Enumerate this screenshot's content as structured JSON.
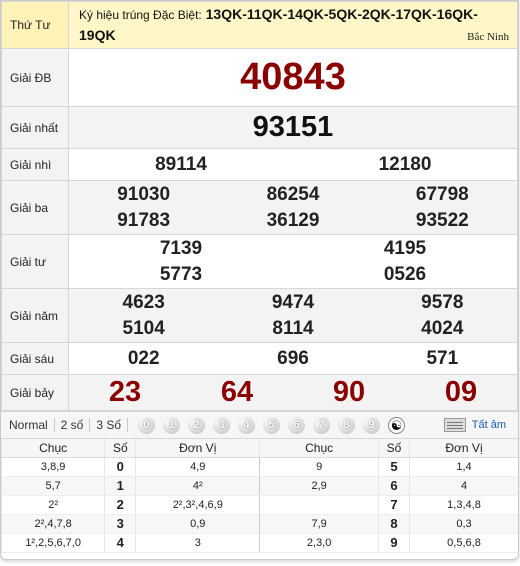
{
  "header": {
    "day_label": "Thứ Tư",
    "special_prefix": "Ký hiệu trúng Đặc Biệt:",
    "special_codes": "13QK-11QK-14QK-5QK-2QK-17QK-16QK-19QK",
    "province": "Bắc Ninh"
  },
  "prizes": {
    "db": {
      "label": "Giải ĐB",
      "values": [
        "40843"
      ]
    },
    "nhat": {
      "label": "Giải nhất",
      "values": [
        "93151"
      ]
    },
    "nhi": {
      "label": "Giải nhì",
      "values": [
        "89114",
        "12180"
      ]
    },
    "ba": {
      "label": "Giải ba",
      "values": [
        "91030",
        "86254",
        "67798",
        "91783",
        "36129",
        "93522"
      ]
    },
    "tu": {
      "label": "Giải tư",
      "values": [
        "7139",
        "4195",
        "5773",
        "0526"
      ]
    },
    "nam": {
      "label": "Giải năm",
      "values": [
        "4623",
        "9474",
        "9578",
        "5104",
        "8114",
        "4024"
      ]
    },
    "sau": {
      "label": "Giải sáu",
      "values": [
        "022",
        "696",
        "571"
      ]
    },
    "bay": {
      "label": "Giải bảy",
      "values": [
        "23",
        "64",
        "90",
        "09"
      ]
    }
  },
  "toolbar": {
    "options": [
      "Normal",
      "2 số",
      "3 Số"
    ],
    "digits": [
      "0",
      "1",
      "2",
      "3",
      "4",
      "5",
      "6",
      "7",
      "8",
      "9"
    ],
    "all_label": "Tất âm",
    "icons": [
      "yin-yang-icon",
      "numbers-icon"
    ]
  },
  "loto": {
    "headers": [
      "Chục",
      "Số",
      "Đơn Vị",
      "Chục",
      "Số",
      "Đơn Vị"
    ],
    "rows": [
      {
        "l_chuc": "3,8,9",
        "l_so": "0",
        "l_dv": "4,9",
        "r_chuc": "9",
        "r_so": "5",
        "r_dv": "1,4"
      },
      {
        "l_chuc": "5,7",
        "l_so": "1",
        "l_dv": "4²",
        "r_chuc": "2,9",
        "r_so": "6",
        "r_dv": "4"
      },
      {
        "l_chuc": "2²",
        "l_so": "2",
        "l_dv": "2²,3²,4,6,9",
        "r_chuc": "",
        "r_so": "7",
        "r_dv": "1,3,4,8"
      },
      {
        "l_chuc": "2²,4,7,8",
        "l_so": "3",
        "l_dv": "0,9",
        "r_chuc": "7,9",
        "r_so": "8",
        "r_dv": "0,3"
      },
      {
        "l_chuc": "1²,2,5,6,7,0",
        "l_so": "4",
        "l_dv": "3",
        "r_chuc": "2,3,0",
        "r_so": "9",
        "r_dv": "0,5,6,8"
      }
    ]
  },
  "colors": {
    "highlight": "#8b0000",
    "header_bg": "#fff7c7",
    "link": "#1a5fb4"
  }
}
